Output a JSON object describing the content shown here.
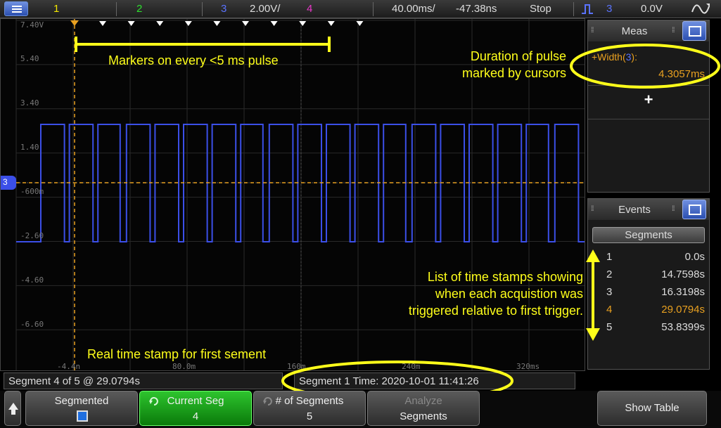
{
  "topbar": {
    "ch1": "1",
    "ch2": "2",
    "ch3": "3",
    "ch3_scale": "2.00V/",
    "ch4": "4",
    "time_scale": "40.00ms/",
    "time_delay": "-47.38ns",
    "run_state": "Stop",
    "trigger_source": "3",
    "trigger_level": "0.0V"
  },
  "colors": {
    "ch1": "#f2e600",
    "ch2": "#2ee02e",
    "ch3": "#3b4fe8",
    "ch4": "#e838c8",
    "cursor": "#e8a020",
    "annotation": "#ffff1a"
  },
  "waveform": {
    "channel_marker": "3",
    "y_labels": [
      "7.40V",
      "5.40",
      "3.40",
      "1.40",
      "-600m",
      "-2.60",
      "-4.60",
      "-6.60"
    ],
    "x_labels": [
      "-4.4n",
      "80.0m",
      "160m",
      "240m",
      "320ms"
    ],
    "pulse_count": 19,
    "annotations": {
      "markers": "Markers on every <5 ms pulse",
      "realtime": "Real time stamp for first sement",
      "duration_line1": "Duration of pulse",
      "duration_line2": "marked by cursors",
      "list_line1": "List of time stamps showing",
      "list_line2": "when each acquistion was",
      "list_line3": "triggered relative to first trigger."
    }
  },
  "meas_panel": {
    "title": "Meas",
    "measurement_label": "+Width(",
    "measurement_channel": "3",
    "measurement_label_end": "):",
    "measurement_value": "4.3057ms",
    "add_label": "+"
  },
  "events_panel": {
    "title": "Events",
    "tab": "Segments",
    "rows": [
      {
        "n": "1",
        "v": "0.0s"
      },
      {
        "n": "2",
        "v": "14.7598s"
      },
      {
        "n": "3",
        "v": "16.3198s"
      },
      {
        "n": "4",
        "v": "29.0794s"
      },
      {
        "n": "5",
        "v": "53.8399s"
      }
    ],
    "selected_index": 3
  },
  "status": {
    "segment": "Segment 4 of 5 @ 29.0794s",
    "segment_time": "Segment 1 Time: 2020-10-01 11:41:26"
  },
  "softkeys": {
    "segmented": "Segmented",
    "current_seg": "Current Seg",
    "current_seg_value": "4",
    "num_segments": "# of Segments",
    "num_segments_value": "5",
    "analyze_l1": "Analyze",
    "analyze_l2": "Segments",
    "show_table": "Show Table"
  }
}
